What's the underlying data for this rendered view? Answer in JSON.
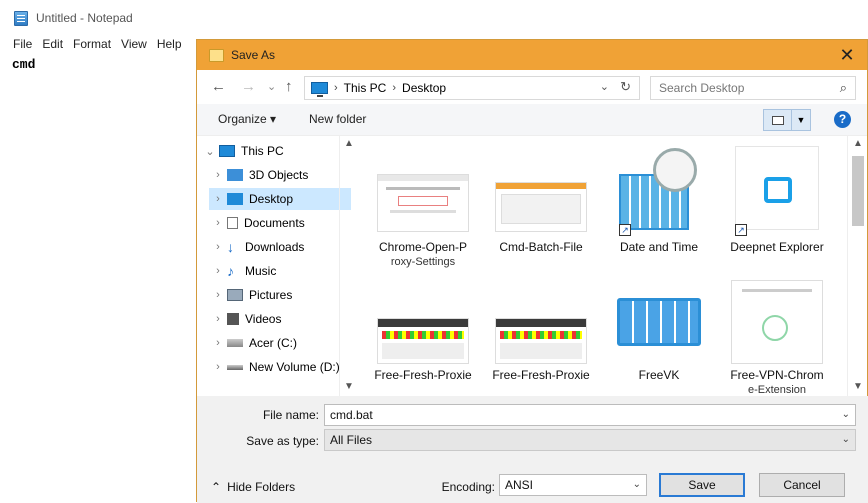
{
  "notepad": {
    "title": "Untitled - Notepad",
    "menu": [
      "File",
      "Edit",
      "Format",
      "View",
      "Help"
    ],
    "content": "cmd"
  },
  "dialog": {
    "title": "Save As",
    "close": "✕",
    "nav": {
      "back": "←",
      "forward": "→",
      "recent": "⌄",
      "up": "↑"
    },
    "breadcrumb": [
      "This PC",
      "Desktop"
    ],
    "breadcrumb_sep": "›",
    "refresh": "↻",
    "search_placeholder": "Search Desktop",
    "toolbar": {
      "organize": "Organize ▾",
      "new_folder": "New folder",
      "help": "?"
    },
    "tree": [
      {
        "label": "This PC",
        "chevron": "⌄",
        "icon": "pc-icon"
      },
      {
        "label": "3D Objects",
        "chevron": "›",
        "icon": "3d-objects-icon"
      },
      {
        "label": "Desktop",
        "chevron": "›",
        "icon": "desktop-icon",
        "selected": true
      },
      {
        "label": "Documents",
        "chevron": "›",
        "icon": "documents-icon"
      },
      {
        "label": "Downloads",
        "chevron": "›",
        "icon": "downloads-icon"
      },
      {
        "label": "Music",
        "chevron": "›",
        "icon": "music-icon"
      },
      {
        "label": "Pictures",
        "chevron": "›",
        "icon": "pictures-icon"
      },
      {
        "label": "Videos",
        "chevron": "›",
        "icon": "videos-icon"
      },
      {
        "label": "Acer (C:)",
        "chevron": "›",
        "icon": "drive-icon"
      },
      {
        "label": "New Volume (D:)",
        "chevron": "›",
        "icon": "drive-icon"
      }
    ],
    "files": [
      {
        "name": "Chrome-Open-P",
        "name2": "roxy-Settings"
      },
      {
        "name": "Cmd-Batch-File",
        "name2": ""
      },
      {
        "name": "Date and Time",
        "name2": ""
      },
      {
        "name": "Deepnet Explorer",
        "name2": ""
      },
      {
        "name": "Free-Fresh-Proxie",
        "name2": ""
      },
      {
        "name": "Free-Fresh-Proxie",
        "name2": ""
      },
      {
        "name": "FreeVK",
        "name2": ""
      },
      {
        "name": "Free-VPN-Chrom",
        "name2": "e-Extension"
      }
    ],
    "file_name_label": "File name:",
    "file_name_value": "cmd.bat",
    "save_as_type_label": "Save as type:",
    "save_as_type_value": "All Files",
    "hide_folders": "Hide Folders",
    "encoding_label": "Encoding:",
    "encoding_value": "ANSI",
    "save": "Save",
    "cancel": "Cancel"
  },
  "colors": {
    "titlebar": "#f0a236",
    "selection": "#cce8ff",
    "accent": "#2a7ad4"
  }
}
